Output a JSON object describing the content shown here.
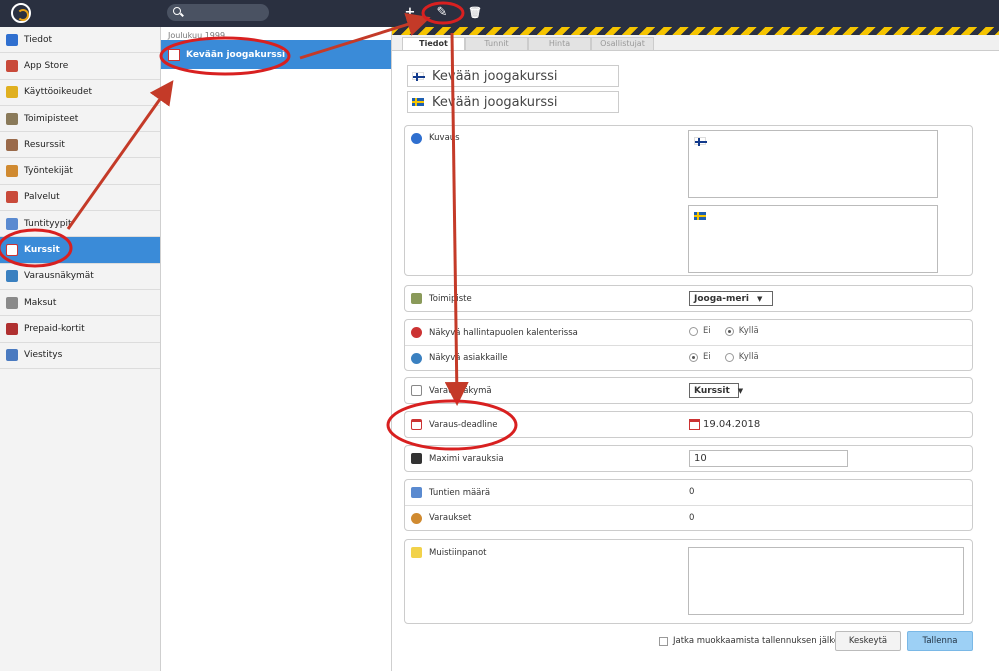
{
  "toolbar": {
    "add": "+",
    "edit": "✎",
    "delete": "🗑"
  },
  "nav": [
    {
      "label": "Tiedot",
      "icon": "info-icon",
      "color": "#2f6fcf"
    },
    {
      "label": "App Store",
      "icon": "app-store-icon",
      "color": "#c94a3a"
    },
    {
      "label": "Käyttöoikeudet",
      "icon": "star-icon",
      "color": "#e0b020"
    },
    {
      "label": "Toimipisteet",
      "icon": "location-icon",
      "color": "#8a7a5a"
    },
    {
      "label": "Resurssit",
      "icon": "resources-icon",
      "color": "#9a6a4a"
    },
    {
      "label": "Työntekijät",
      "icon": "employees-icon",
      "color": "#d08a30"
    },
    {
      "label": "Palvelut",
      "icon": "calendar-icon",
      "color": "#c94a3a"
    },
    {
      "label": "Tuntityypit",
      "icon": "lesson-types-icon",
      "color": "#5a8ad0"
    },
    {
      "label": "Kurssit",
      "icon": "courses-icon",
      "color": "#ffffff",
      "active": true
    },
    {
      "label": "Varausnäkymät",
      "icon": "globe-icon",
      "color": "#3a80c0"
    },
    {
      "label": "Maksut",
      "icon": "payments-icon",
      "color": "#8a8a8a"
    },
    {
      "label": "Prepaid-kortit",
      "icon": "card-icon",
      "color": "#b03030"
    },
    {
      "label": "Viestitys",
      "icon": "chat-icon",
      "color": "#4a7ac0"
    }
  ],
  "list": {
    "group": "Joulukuu 1999",
    "item": "Kevään joogakurssi"
  },
  "tabs": [
    "Tiedot",
    "Tunnit",
    "Hinta",
    "Osallistujat"
  ],
  "names": {
    "fi": "Kevään joogakurssi",
    "sv": "Kevään joogakurssi"
  },
  "form": {
    "description": "Kuvaus",
    "location_label": "Toimipiste",
    "location_value": "Jooga-meri",
    "visible_admin": "Näkyvä hallintapuolen kalenterissa",
    "visible_customers": "Näkyvä asiakkaille",
    "no": "Ei",
    "yes": "Kyllä",
    "booking_view_label": "Varausnäkymä",
    "booking_view_value": "Kurssit",
    "deadline_label": "Varaus-deadline",
    "deadline_value": "19.04.2018",
    "max_label": "Maximi varauksia",
    "max_value": "10",
    "hours_label": "Tuntien määrä",
    "hours_value": "0",
    "bookings_label": "Varaukset",
    "bookings_value": "0",
    "notes_label": "Muistiinpanot"
  },
  "footer": {
    "continue": "Jatka muokkaamista tallennuksen jälkeen",
    "cancel": "Keskeytä",
    "save": "Tallenna"
  }
}
